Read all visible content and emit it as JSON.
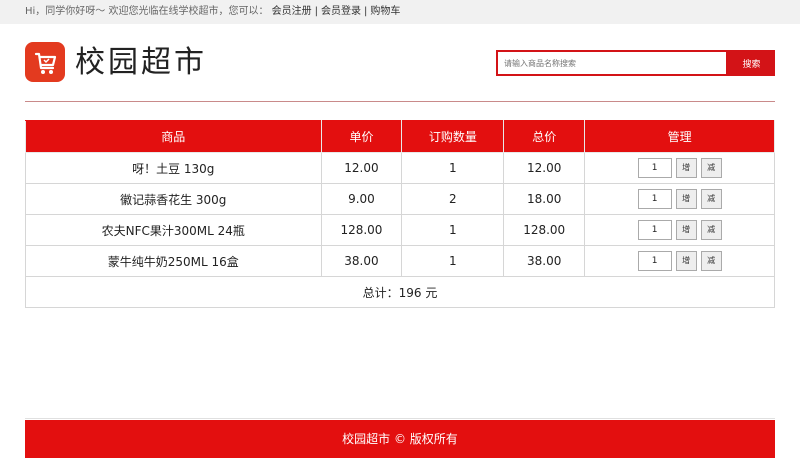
{
  "topbar": {
    "greeting": "Hi，同学你好呀～ 欢迎您光临在线学校超市，您可以：",
    "register": "会员注册",
    "separator": "|",
    "login": "会员登录",
    "cart": "购物车"
  },
  "header": {
    "logo_text": "校园超市",
    "search_placeholder": "请输入商品名称搜索",
    "search_button": "搜索"
  },
  "cart": {
    "headers": [
      "商品",
      "单价",
      "订购数量",
      "总价",
      "管理"
    ],
    "rows": [
      {
        "name": "呀！土豆 130g",
        "price": "12.00",
        "qty": "1",
        "total": "12.00",
        "input": "1"
      },
      {
        "name": "徽记蒜香花生 300g",
        "price": "9.00",
        "qty": "2",
        "total": "18.00",
        "input": "1"
      },
      {
        "name": "农夫NFC果汁300ML 24瓶",
        "price": "128.00",
        "qty": "1",
        "total": "128.00",
        "input": "1"
      },
      {
        "name": "蒙牛纯牛奶250ML 16盒",
        "price": "38.00",
        "qty": "1",
        "total": "38.00",
        "input": "1"
      }
    ],
    "add_label": "增",
    "sub_label": "减",
    "summary": "总计：196 元"
  },
  "footer": {
    "text": "校园超市 © 版权所有"
  },
  "colors": {
    "brand_red": "#e30f0f",
    "logo_orange": "#e33a1f"
  }
}
